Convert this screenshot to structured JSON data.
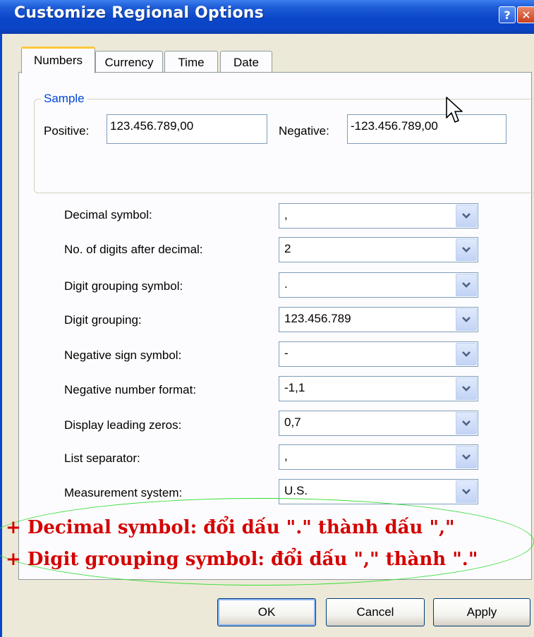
{
  "window": {
    "title": "Customize Regional Options",
    "help_label": "?",
    "close_label": "✕"
  },
  "tabs": [
    {
      "label": "Numbers",
      "active": true
    },
    {
      "label": "Currency",
      "active": false
    },
    {
      "label": "Time",
      "active": false
    },
    {
      "label": "Date",
      "active": false
    }
  ],
  "sample": {
    "legend": "Sample",
    "positive_label": "Positive:",
    "positive_value": "123.456.789,00",
    "negative_label": "Negative:",
    "negative_value": "-123.456.789,00"
  },
  "settings": [
    {
      "label": "Decimal symbol:",
      "value": ","
    },
    {
      "label": "No. of digits after decimal:",
      "value": "2"
    },
    {
      "label": "Digit grouping symbol:",
      "value": "."
    },
    {
      "label": "Digit grouping:",
      "value": "123.456.789"
    },
    {
      "label": "Negative sign symbol:",
      "value": "-"
    },
    {
      "label": "Negative number format:",
      "value": "-1,1"
    },
    {
      "label": "Display leading zeros:",
      "value": "0,7"
    },
    {
      "label": "List separator:",
      "value": ","
    },
    {
      "label": "Measurement system:",
      "value": "U.S."
    }
  ],
  "annotation": {
    "line1": "+ Decimal symbol: đổi dấu \".\" thành dấu \",\"",
    "line2": "+ Digit grouping symbol: đổi dấu \",\" thành \".\""
  },
  "buttons": {
    "ok": "OK",
    "cancel": "Cancel",
    "apply": "Apply"
  },
  "colors": {
    "title_bar": "#0a46c9",
    "accent_tab": "#ffc83c",
    "annotation_text": "#d40000",
    "annotation_outline": "#33dd33",
    "group_legend": "#0046d5"
  },
  "icons": {
    "combo": "chevron-down-icon",
    "cursor": "mouse-pointer-icon"
  }
}
